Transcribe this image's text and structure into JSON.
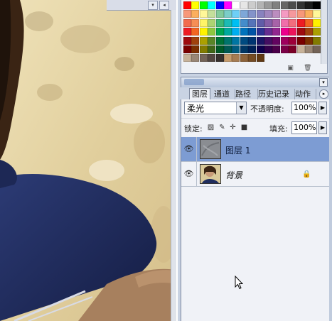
{
  "canvas": {
    "scroll_buttons": [
      "▾",
      "◂"
    ]
  },
  "swatches": {
    "colors": [
      [
        "#ff0000",
        "#ffff00",
        "#00ff00",
        "#00ffff",
        "#0000ff",
        "#ff00ff",
        "#ffffff",
        "#e6e6e6",
        "#cccccc",
        "#b3b3b3",
        "#999999",
        "#808080",
        "#666666",
        "#4d4d4d",
        "#333333",
        "#1a1a1a",
        "#000000"
      ],
      [
        "#f7977a",
        "#fbaf5d",
        "#fff799",
        "#c4df9b",
        "#82ca9c",
        "#7bcdc8",
        "#6ecff6",
        "#7ea7d8",
        "#8493ca",
        "#8882be",
        "#a187be",
        "#bc8dbf",
        "#f49ac2",
        "#f6989d",
        "#f7977a",
        "#fbaf5d",
        "#fff799"
      ],
      [
        "#f26c4f",
        "#f68e56",
        "#fff467",
        "#acd372",
        "#3cb878",
        "#1cbbb4",
        "#00bff3",
        "#448ccb",
        "#5574b9",
        "#605ca8",
        "#855fa8",
        "#a763a8",
        "#f06eaa",
        "#f26d7d",
        "#ed1c24",
        "#f26522",
        "#fff200"
      ],
      [
        "#ed1c24",
        "#f26522",
        "#fff200",
        "#8dc73f",
        "#00a651",
        "#00a99d",
        "#00aeef",
        "#0072bc",
        "#0054a6",
        "#2e3192",
        "#662d91",
        "#92278f",
        "#ec008c",
        "#ed145b",
        "#9e0b0f",
        "#a0410d",
        "#aba000"
      ],
      [
        "#9e0b0f",
        "#a0410d",
        "#aba000",
        "#598527",
        "#007236",
        "#00746b",
        "#0076a3",
        "#004a80",
        "#003471",
        "#1b1464",
        "#440e62",
        "#630460",
        "#9e005d",
        "#9e0039",
        "#790000",
        "#7b2e00",
        "#827b00"
      ],
      [
        "#790000",
        "#7b2e00",
        "#827b00",
        "#406618",
        "#005826",
        "#005952",
        "#005b7f",
        "#003663",
        "#002157",
        "#0d004c",
        "#32004b",
        "#4b0049",
        "#7b0046",
        "#7a0026",
        "#c7b299",
        "#998675",
        "#736357"
      ],
      [
        "#c7b299",
        "#998675",
        "#736357",
        "#534741",
        "#37302d",
        "#c69c6d",
        "#a67c52",
        "#8c6239",
        "#754c24",
        "#603913"
      ]
    ],
    "footer_icons": [
      "new-swatch-icon",
      "trash-icon"
    ]
  },
  "layers_panel": {
    "tabs": [
      "图层",
      "通道",
      "路径",
      "历史记录",
      "动作"
    ],
    "active_tab": "图层",
    "blend_mode": "柔光",
    "opacity_label": "不透明度:",
    "opacity_value": "100%",
    "lock_label": "锁定:",
    "fill_label": "填充:",
    "fill_value": "100%",
    "layers": [
      {
        "name": "图层 1",
        "visible": true,
        "selected": true,
        "locked": false
      },
      {
        "name": "背景",
        "visible": true,
        "selected": false,
        "locked": true
      }
    ]
  },
  "colors": {
    "selection": "#7d9cd3",
    "panel_bg": "#f0f2f7",
    "shirt": "#1f2d5e",
    "bark": "#e4d5a8"
  }
}
